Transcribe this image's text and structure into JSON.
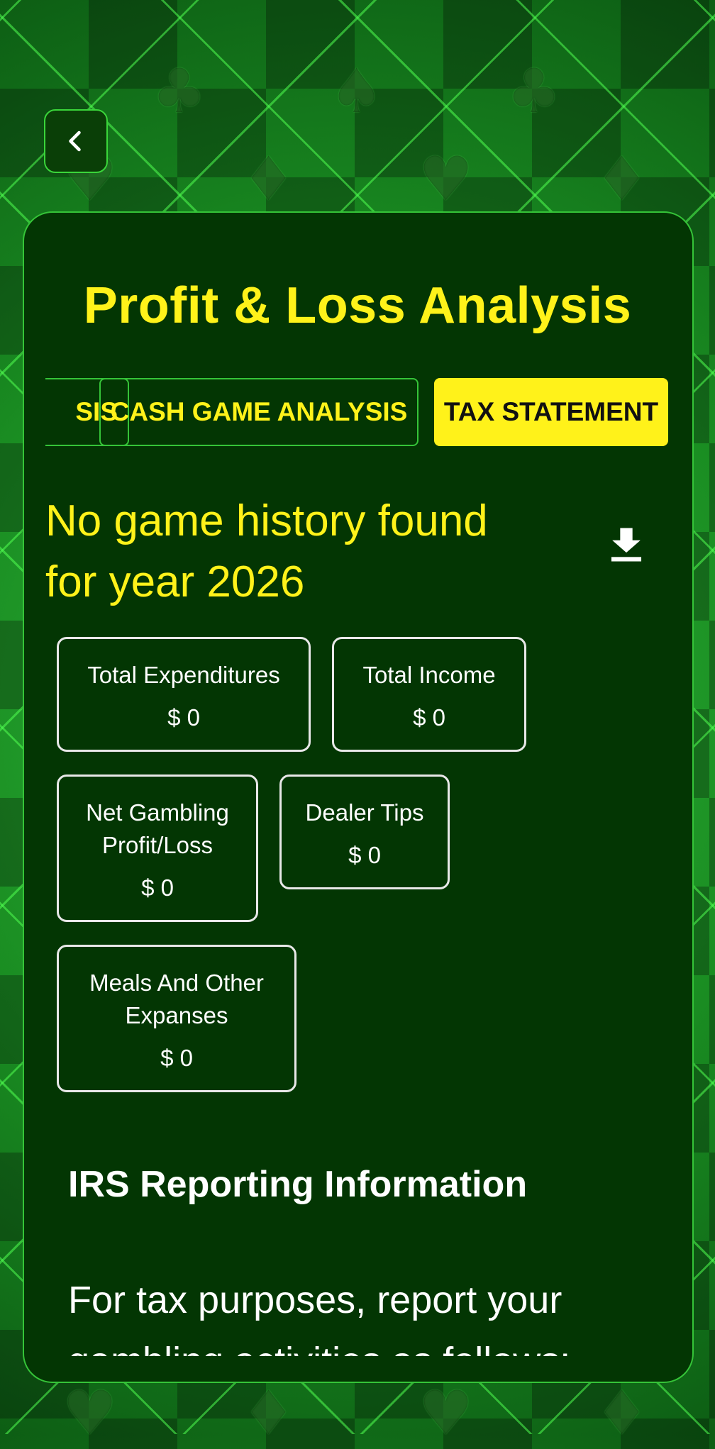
{
  "header": {
    "back_icon": "chevron-left-icon",
    "title": "Profit & Loss Analysis"
  },
  "tabs": [
    {
      "label": "ANALYSIS",
      "visible_fragment": "SIS",
      "active": false
    },
    {
      "label": "CASH GAME ANALYSIS",
      "active": false
    },
    {
      "label": "TAX STATEMENT",
      "active": true
    }
  ],
  "message": {
    "line1": "No game history found",
    "line2": "for year 2026",
    "download_icon": "download-icon"
  },
  "stats": {
    "total_expenditures": {
      "label": "Total Expenditures",
      "value": "$ 0"
    },
    "total_income": {
      "label": "Total Income",
      "value": "$ 0"
    },
    "net_gambling": {
      "label_line1": "Net Gambling",
      "label_line2": "Profit/Loss",
      "value": "$ 0"
    },
    "dealer_tips": {
      "label": "Dealer Tips",
      "value": "$ 0"
    },
    "meals": {
      "label_line1": "Meals And Other",
      "label_line2": "Expanses",
      "value": "$ 0"
    }
  },
  "irs": {
    "title": "IRS Reporting Information",
    "body_line1": "For tax purposes, report your",
    "body_line2": "gambling activities as follows:"
  },
  "colors": {
    "accent_yellow": "#fff21a",
    "card_green": "#033603",
    "border_green": "#35c438"
  }
}
